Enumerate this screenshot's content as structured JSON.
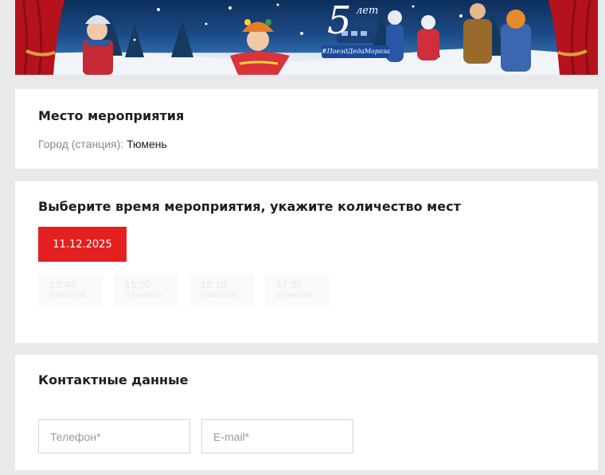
{
  "banner": {
    "years_number": "5",
    "years_word": "лет",
    "tagline": "#ПоездДедаМороза"
  },
  "venue": {
    "title": "Место мероприятия",
    "city_label": "Город (станция): ",
    "city_value": "Тюмень"
  },
  "time": {
    "title": "Выберите время мероприятия, укажите количество мест",
    "selected_date": "11.12.2025",
    "slots": [
      {
        "time": "13:40",
        "tickets": "0 билетов"
      },
      {
        "time": "15:00",
        "tickets": "0 билетов"
      },
      {
        "time": "16:10",
        "tickets": "0 билетов"
      },
      {
        "time": "17:30",
        "tickets": "0 билетов"
      }
    ]
  },
  "contact": {
    "title": "Контактные данные",
    "phone_placeholder": "Телефон*",
    "email_placeholder": "E-mail*"
  },
  "colors": {
    "accent": "#e3201f",
    "page_bg": "#e9e9eb"
  }
}
